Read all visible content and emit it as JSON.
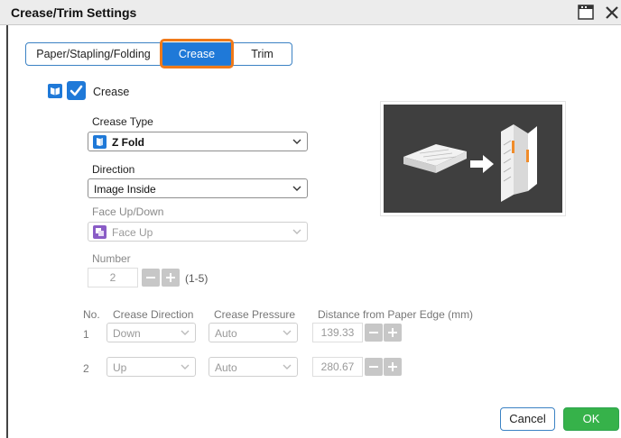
{
  "dialog": {
    "title": "Crease/Trim Settings"
  },
  "tabs": [
    {
      "label": "Paper/Stapling/Folding",
      "active": false
    },
    {
      "label": "Crease",
      "active": true
    },
    {
      "label": "Trim",
      "active": false
    }
  ],
  "crease": {
    "label": "Crease",
    "checked": true
  },
  "crease_type": {
    "label": "Crease Type",
    "value": "Z Fold"
  },
  "direction": {
    "label": "Direction",
    "value": "Image Inside"
  },
  "face": {
    "label": "Face Up/Down",
    "value": "Face Up",
    "disabled": true
  },
  "number": {
    "label": "Number",
    "value": "2",
    "range": "(1-5)",
    "disabled": true
  },
  "table": {
    "headers": {
      "no": "No.",
      "direction": "Crease Direction",
      "pressure": "Crease Pressure",
      "distance": "Distance from Paper Edge (mm)"
    },
    "rows": [
      {
        "no": "1",
        "direction": "Down",
        "pressure": "Auto",
        "distance": "139.33"
      },
      {
        "no": "2",
        "direction": "Up",
        "pressure": "Auto",
        "distance": "280.67"
      }
    ]
  },
  "buttons": {
    "cancel": "Cancel",
    "ok": "OK"
  },
  "colors": {
    "accent": "#1f79d8",
    "highlight": "#f07a1a",
    "ok_green": "#36b24a",
    "preview_bg": "#3f3f3f"
  }
}
